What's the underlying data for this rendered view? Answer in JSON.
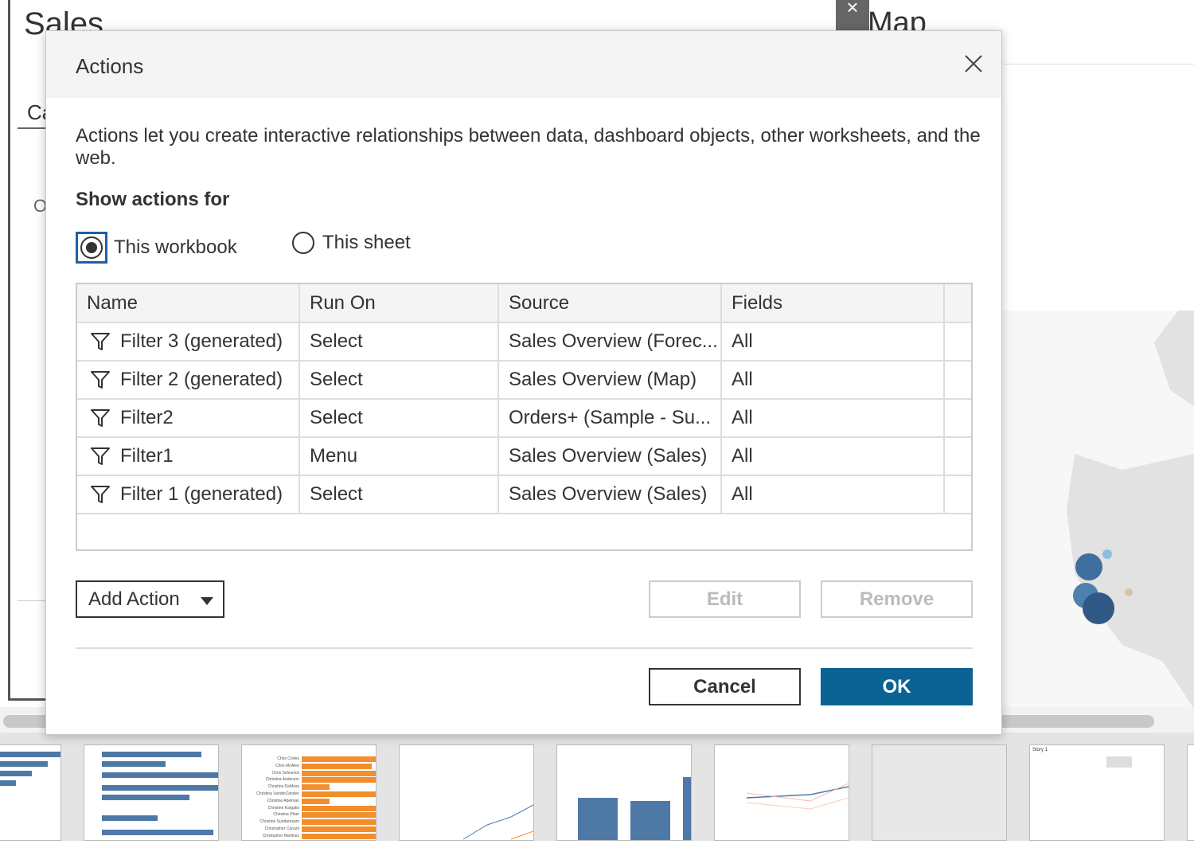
{
  "background": {
    "left_title": "Sales",
    "left_tab_partial": "Ca",
    "left_label_partial": "O",
    "right_title": "Map",
    "thumb_texts": {
      "names": [
        "Chris Cortes",
        "Chris McAfee",
        "Chris Selesnick",
        "Christina Anderson",
        "Christina DeMoss",
        "Christina VanderZanden",
        "Christine Abelman",
        "Christine Kargatis",
        "Christine Phan",
        "Christine Sundaresam",
        "Christopher Conant",
        "Christopher Martinez"
      ],
      "story": "Story 1"
    }
  },
  "dialog": {
    "title": "Actions",
    "close_icon": "close-x-icon",
    "description": "Actions let you create interactive relationships between data, dashboard objects, other worksheets, and the web.",
    "show_actions_for": "Show actions for",
    "radio_options": [
      {
        "label": "This workbook",
        "selected": true
      },
      {
        "label": "This sheet",
        "selected": false
      }
    ],
    "table": {
      "columns": [
        "Name",
        "Run On",
        "Source",
        "Fields"
      ],
      "rows": [
        {
          "icon": "filter-icon",
          "name": "Filter 3 (generated)",
          "run_on": "Select",
          "source": "Sales Overview (Forec...",
          "fields": "All"
        },
        {
          "icon": "filter-icon",
          "name": "Filter 2 (generated)",
          "run_on": "Select",
          "source": "Sales Overview (Map)",
          "fields": "All"
        },
        {
          "icon": "filter-icon",
          "name": "Filter2",
          "run_on": "Select",
          "source": "Orders+ (Sample - Su...",
          "fields": "All"
        },
        {
          "icon": "filter-icon",
          "name": "Filter1",
          "run_on": "Menu",
          "source": "Sales Overview (Sales)",
          "fields": "All"
        },
        {
          "icon": "filter-icon",
          "name": "Filter 1 (generated)",
          "run_on": "Select",
          "source": "Sales Overview (Sales)",
          "fields": "All"
        }
      ]
    },
    "add_action": "Add Action",
    "edit": "Edit",
    "remove": "Remove",
    "cancel": "Cancel",
    "ok": "OK",
    "colors": {
      "primary": "#0b6394",
      "focus": "#1f5fa6",
      "disabled": "#bbbbbb"
    }
  }
}
